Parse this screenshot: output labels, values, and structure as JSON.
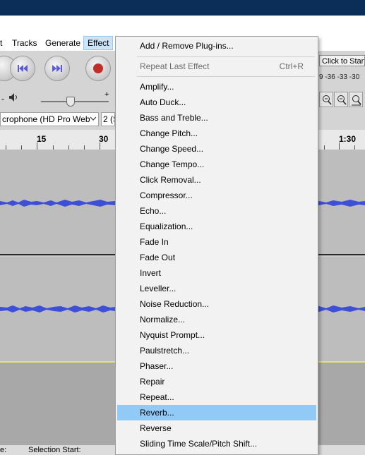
{
  "menubar": {
    "items": [
      "t",
      "Tracks",
      "Generate",
      "Effect"
    ]
  },
  "toolbar": {
    "device": "crophone (HD Pro Web",
    "channels": "2 (S",
    "click_to_start": "Click to Start",
    "meter_scale": "9 -36 -33 -30"
  },
  "ruler": {
    "labels": [
      "15",
      "30",
      "1:30"
    ]
  },
  "statusbar": {
    "left": "e:",
    "selection_start": "Selection Start:"
  },
  "effect_menu": {
    "add_remove": "Add / Remove Plug-ins...",
    "repeat_last": "Repeat Last Effect",
    "repeat_last_shortcut": "Ctrl+R",
    "items": [
      "Amplify...",
      "Auto Duck...",
      "Bass and Treble...",
      "Change Pitch...",
      "Change Speed...",
      "Change Tempo...",
      "Click Removal...",
      "Compressor...",
      "Echo...",
      "Equalization...",
      "Fade In",
      "Fade Out",
      "Invert",
      "Leveller...",
      "Noise Reduction...",
      "Normalize...",
      "Nyquist Prompt...",
      "Paulstretch...",
      "Phaser...",
      "Repair",
      "Repeat...",
      "Reverb...",
      "Reverse",
      "Sliding Time Scale/Pitch Shift..."
    ],
    "highlighted_item": "Reverb..."
  },
  "colors": {
    "title_bar": "#0b2e59",
    "highlight": "#91c9f7",
    "waveform": "#3d4fd6"
  }
}
